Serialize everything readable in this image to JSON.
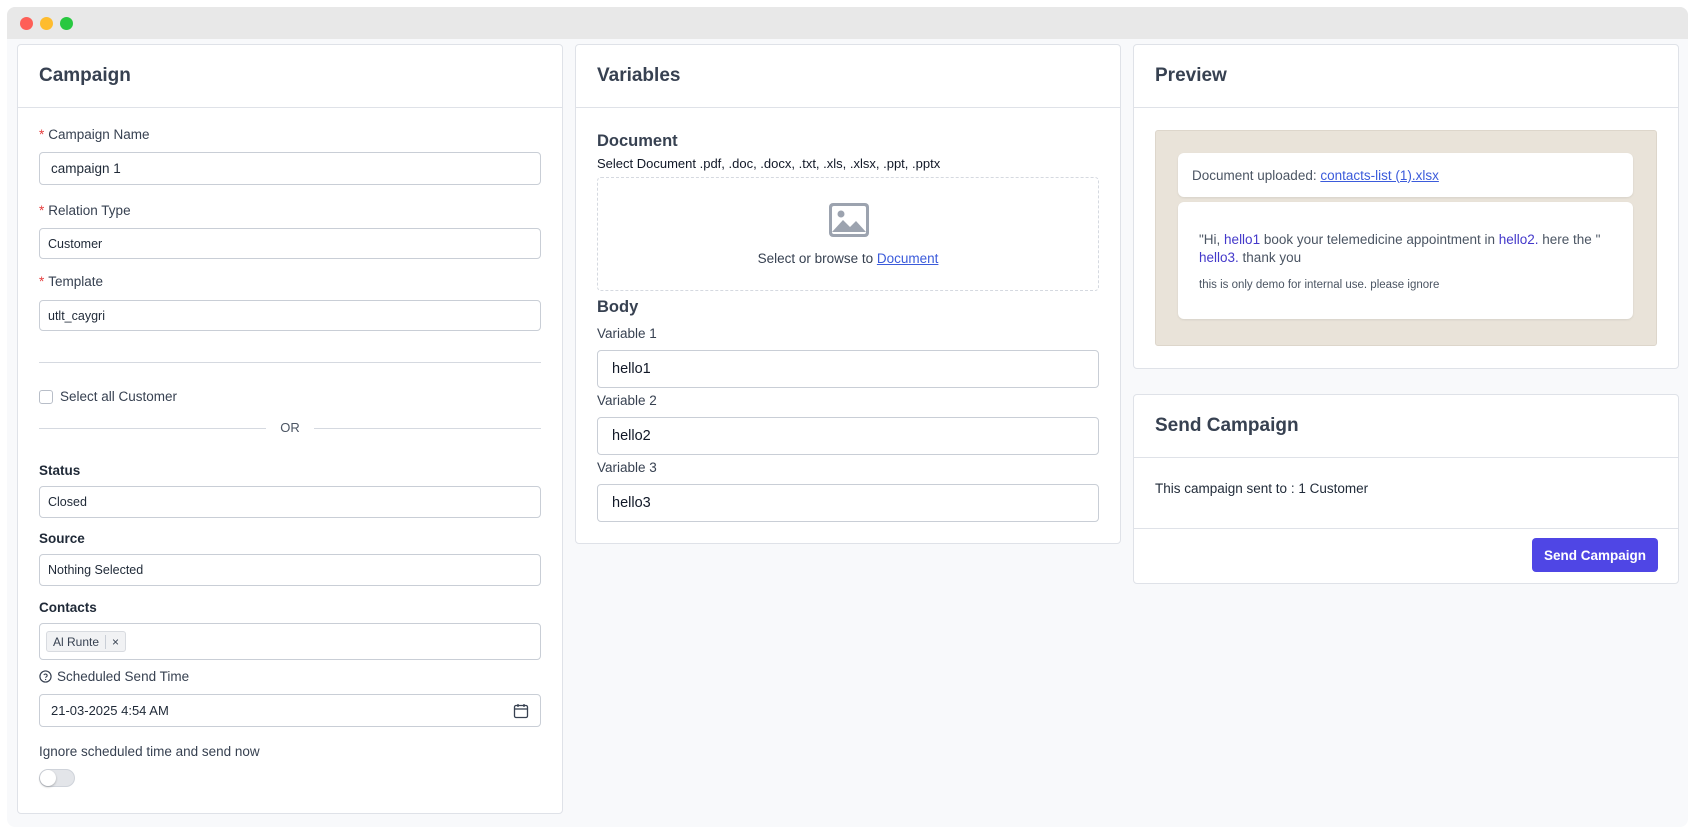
{
  "campaign": {
    "title": "Campaign",
    "name_label": "Campaign Name",
    "name_value": "campaign 1",
    "relation_label": "Relation Type",
    "relation_value": "Customer",
    "template_label": "Template",
    "template_value": "utlt_caygri",
    "select_all_label": "Select all Customer",
    "or_text": "OR",
    "status_label": "Status",
    "status_value": "Closed",
    "source_label": "Source",
    "source_value": "Nothing Selected",
    "contacts_label": "Contacts",
    "contacts": [
      {
        "name": "Al Runte",
        "remove": "×"
      }
    ],
    "scheduled_label": "Scheduled Send Time",
    "scheduled_value": "21-03-2025 4:54 AM",
    "ignore_label": "Ignore scheduled time and send now",
    "ignore_enabled": false
  },
  "variables": {
    "title": "Variables",
    "document_heading": "Document",
    "document_hint": "Select Document .pdf, .doc, .docx, .txt, .xls, .xlsx, .ppt, .pptx",
    "dropzone_text": "Select or browse to",
    "dropzone_link": "Document",
    "body_heading": "Body",
    "items": [
      {
        "label": "Variable 1",
        "value": "hello1"
      },
      {
        "label": "Variable 2",
        "value": "hello2"
      },
      {
        "label": "Variable 3",
        "value": "hello3"
      }
    ]
  },
  "preview": {
    "title": "Preview",
    "doc_prefix": "Document uploaded:",
    "doc_link": "contacts-list (1).xlsx",
    "msg_part1": "\"Hi, ",
    "msg_var1": "hello1",
    "msg_part2": " book your telemedicine appointment in ",
    "msg_var2": "hello2.",
    "msg_part3": " here the \"",
    "msg_var3": "hello3.",
    "msg_part4": " thank you",
    "footer_note": "this is only demo for internal use. please ignore"
  },
  "send": {
    "title": "Send Campaign",
    "summary": "This campaign sent to : 1 Customer",
    "button_label": "Send Campaign"
  },
  "colors": {
    "accent": "#4f46e5",
    "required": "#e53e3e",
    "link": "#3b5bdb",
    "preview_bg": "#e9e3d9"
  }
}
